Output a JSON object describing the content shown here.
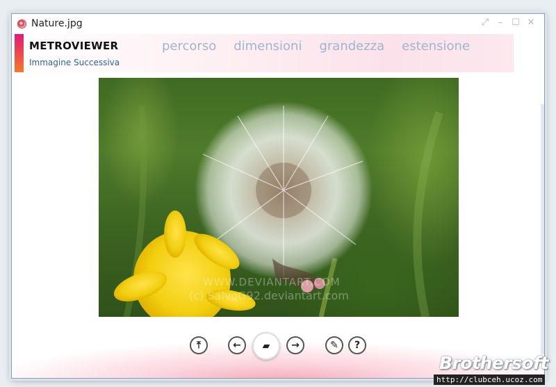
{
  "window": {
    "title": "Nature.jpg"
  },
  "header": {
    "app_name": "METROVIEWER",
    "next_image_label": "Immagine Successiva",
    "menu": [
      "percorso",
      "dimensioni",
      "grandezza",
      "estensione"
    ]
  },
  "image": {
    "subject": "dandelion photo",
    "watermark_line1": "WWW.DEVIANTART.COM",
    "watermark_line2": "(c) SalvoG92.deviantart.com"
  },
  "toolbar": {
    "buttons": [
      {
        "name": "top-icon",
        "glyph": "⤒"
      },
      {
        "name": "previous-icon",
        "glyph": "←"
      },
      {
        "name": "folder-icon",
        "glyph": "▰"
      },
      {
        "name": "next-icon",
        "glyph": "→"
      },
      {
        "name": "edit-icon",
        "glyph": "✎"
      },
      {
        "name": "help-icon",
        "glyph": "?"
      }
    ]
  },
  "watermark": {
    "brand": "Brothersoft",
    "url": "http://clubceh.ucoz.com"
  },
  "colors": {
    "accent_start": "#e0197c",
    "accent_end": "#f07a2a",
    "menu": "#9fb5cc",
    "link": "#2d62a8"
  }
}
